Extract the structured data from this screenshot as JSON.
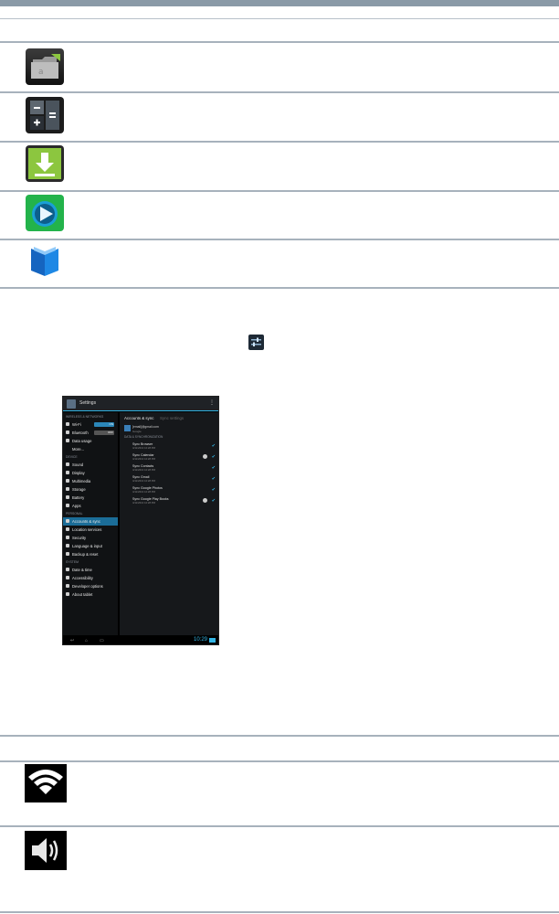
{
  "screenshot": {
    "title": "Settings",
    "menu_glyph": "⋮",
    "sidebar": {
      "sections": {
        "wireless": "WIRELESS & NETWORKS",
        "device": "DEVICE",
        "personal": "PERSONAL",
        "system": "SYSTEM"
      },
      "wireless_items": [
        "Wi-Fi",
        "Bluetooth",
        "Data usage",
        "More..."
      ],
      "wifi_toggle": "ON",
      "bluetooth_toggle": "OFF",
      "device_items": [
        "Sound",
        "Display",
        "Multimedia",
        "Storage",
        "Battery",
        "Apps"
      ],
      "personal_items": [
        "Accounts & sync",
        "Location services",
        "Security",
        "Language & input",
        "Backup & reset"
      ],
      "system_items": [
        "Date & time",
        "Accessibility",
        "Developer options",
        "About tablet"
      ]
    },
    "pane": {
      "header": "Accounts & sync",
      "header_sub": "Sync settings",
      "account_email": "[email]@gmail.com",
      "account_sub": "Google",
      "section": "DATA & SYNCHRONIZATION",
      "rows": [
        {
          "title": "Sync Browser",
          "sub": "4/11/2013 10:28 PM"
        },
        {
          "title": "Sync Calendar",
          "sub": "4/11/2013 10:28 PM"
        },
        {
          "title": "Sync Contacts",
          "sub": "4/11/2013 10:28 PM"
        },
        {
          "title": "Sync Gmail",
          "sub": "4/11/2013 10:28 PM"
        },
        {
          "title": "Sync Google Photos",
          "sub": "4/11/2013 10:28 PM"
        },
        {
          "title": "Sync Google Play Books",
          "sub": "4/11/2013 10:28 PM"
        }
      ],
      "check_glyph": "✔"
    },
    "navbar": {
      "back": "↩",
      "home": "⌂",
      "recent": "▭",
      "clock": "10:29"
    }
  },
  "icons": {
    "top": [
      "file-manager-icon",
      "calculator-icon",
      "downloads-icon",
      "media-player-icon",
      "play-books-icon"
    ],
    "inline": "settings-icon",
    "bottom": [
      "wifi-icon",
      "volume-icon"
    ]
  },
  "colors": {
    "rule": "#a7b2bc",
    "accent": "#33b5e5",
    "download_green": "#8cc63f",
    "media_green": "#23b34b",
    "books_blue": "#1e88e5"
  }
}
